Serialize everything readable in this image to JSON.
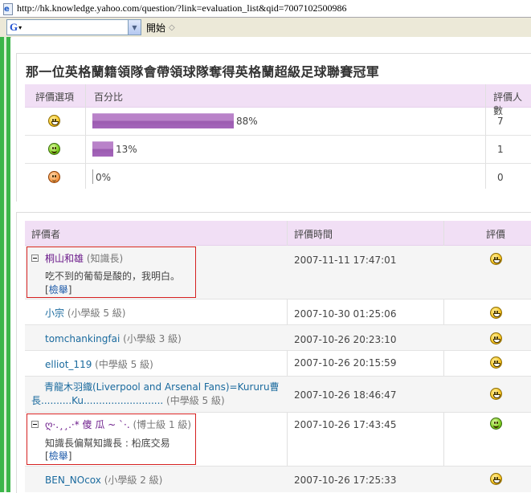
{
  "browser": {
    "url": "http://hk.knowledge.yahoo.com/question/?link=evaluation_list&qid=7007102500986",
    "search_logo": "G",
    "go_label": "開始"
  },
  "question": {
    "title": "那一位英格蘭籍領隊會帶領球隊奪得英格蘭超級足球聯賽冠軍"
  },
  "summary": {
    "headers": {
      "option": "評價選項",
      "percent": "百分比",
      "count": "評價人數"
    },
    "rows": [
      {
        "icon": "happy-face-icon",
        "percent_label": "88%",
        "percent": 88,
        "count": "7"
      },
      {
        "icon": "smile-face-icon",
        "percent_label": "13%",
        "percent": 13,
        "count": "1"
      },
      {
        "icon": "neutral-face-icon",
        "percent_label": "0%",
        "percent": 0,
        "count": "0"
      }
    ],
    "bar_color": "#a566bb"
  },
  "evaluators": {
    "headers": {
      "name": "評價者",
      "time": "評價時間",
      "rating": "評價"
    },
    "report_label": "檢舉",
    "rows": [
      {
        "name": "桐山和雄",
        "rank": "(知識長)",
        "time": "2007-11-11 17:47:01",
        "comment": "吃不到的葡萄是酸的，我明白。",
        "icon": "happy-face-icon"
      },
      {
        "name": "小宗",
        "rank": "(小學級 5 級)",
        "time": "2007-10-30 01:25:06",
        "icon": "happy-face-icon"
      },
      {
        "name": "tomchankingfai",
        "rank": "(小學級 3 級)",
        "time": "2007-10-26 20:23:10",
        "icon": "happy-face-icon"
      },
      {
        "name": "elliot_119",
        "rank": "(中學級 5 級)",
        "time": "2007-10-26 20:15:59",
        "icon": "happy-face-icon"
      },
      {
        "name_line1": "青龍木羽織(Liverpool and Arsenal Fans)=Kururu曹",
        "name_line2": "長..........Ku..........................",
        "rank": "(中學級 5 級)",
        "time": "2007-10-26 18:46:47",
        "icon": "happy-face-icon"
      },
      {
        "name": "ღ·.¸¸.·* 傻 瓜 ~ `·.",
        "rank": "(博士級 1 級)",
        "time": "2007-10-26 17:43:45",
        "comment": "知識長偏幫知識長 : 柗底交易",
        "icon": "smile-face-icon"
      },
      {
        "name": "BEN_NOcox",
        "rank": "(小學級 2 級)",
        "time": "2007-10-26 17:25:33",
        "icon": "happy-face-icon"
      }
    ],
    "highlight_color": "#d52020"
  }
}
